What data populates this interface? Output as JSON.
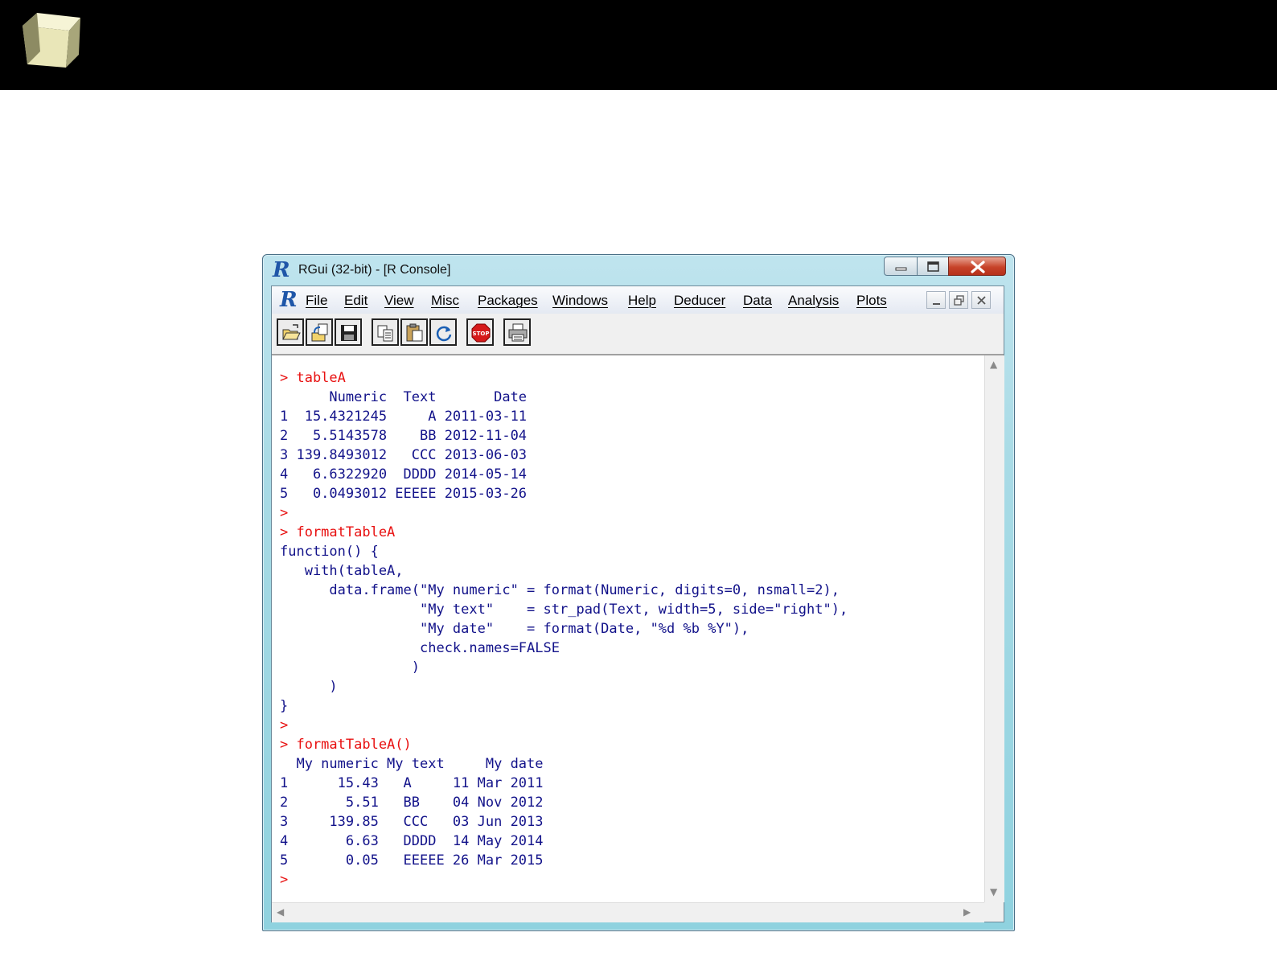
{
  "window": {
    "title": "RGui (32-bit) - [R Console]",
    "logo_letter": "R"
  },
  "menu": {
    "items": [
      {
        "id": "file",
        "label": "File"
      },
      {
        "id": "edit",
        "label": "Edit"
      },
      {
        "id": "view",
        "label": "View"
      },
      {
        "id": "misc",
        "label": "Misc"
      },
      {
        "id": "packages",
        "label": "Packages"
      },
      {
        "id": "windows",
        "label": "Windows"
      },
      {
        "id": "help",
        "label": "Help"
      },
      {
        "id": "deducer",
        "label": "Deducer"
      },
      {
        "id": "data",
        "label": "Data"
      },
      {
        "id": "analysis",
        "label": "Analysis"
      },
      {
        "id": "plots",
        "label": "Plots"
      }
    ]
  },
  "toolbar": {
    "buttons": [
      "open-script-icon",
      "load-workspace-icon",
      "save-icon",
      "copy-icon",
      "paste-icon",
      "refresh-icon",
      "stop-icon",
      "print-icon"
    ],
    "stop_label": "STOP"
  },
  "console": {
    "lines": [
      {
        "kind": "in",
        "text": "> tableA"
      },
      {
        "kind": "out",
        "text": "      Numeric  Text       Date"
      },
      {
        "kind": "out",
        "text": "1  15.4321245     A 2011-03-11"
      },
      {
        "kind": "out",
        "text": "2   5.5143578    BB 2012-11-04"
      },
      {
        "kind": "out",
        "text": "3 139.8493012   CCC 2013-06-03"
      },
      {
        "kind": "out",
        "text": "4   6.6322920  DDDD 2014-05-14"
      },
      {
        "kind": "out",
        "text": "5   0.0493012 EEEEE 2015-03-26"
      },
      {
        "kind": "in",
        "text": ">"
      },
      {
        "kind": "in",
        "text": "> formatTableA"
      },
      {
        "kind": "out",
        "text": "function() {"
      },
      {
        "kind": "out",
        "text": "   with(tableA,"
      },
      {
        "kind": "out",
        "text": "      data.frame(\"My numeric\" = format(Numeric, digits=0, nsmall=2),"
      },
      {
        "kind": "out",
        "text": "                 \"My text\"    = str_pad(Text, width=5, side=\"right\"),"
      },
      {
        "kind": "out",
        "text": "                 \"My date\"    = format(Date, \"%d %b %Y\"),"
      },
      {
        "kind": "out",
        "text": "                 check.names=FALSE"
      },
      {
        "kind": "out",
        "text": "                )"
      },
      {
        "kind": "out",
        "text": "      )"
      },
      {
        "kind": "out",
        "text": "}"
      },
      {
        "kind": "in",
        "text": ">"
      },
      {
        "kind": "in",
        "text": "> formatTableA()"
      },
      {
        "kind": "out",
        "text": "  My numeric My text     My date"
      },
      {
        "kind": "out",
        "text": "1      15.43   A     11 Mar 2011"
      },
      {
        "kind": "out",
        "text": "2       5.51   BB    04 Nov 2012"
      },
      {
        "kind": "out",
        "text": "3     139.85   CCC   03 Jun 2013"
      },
      {
        "kind": "out",
        "text": "4       6.63   DDDD  14 May 2014"
      },
      {
        "kind": "out",
        "text": "5       0.05   EEEEE 26 Mar 2015"
      },
      {
        "kind": "in",
        "text": ">"
      }
    ]
  },
  "colors": {
    "input_text": "#e81010",
    "output_text": "#12128a",
    "banner": "#000000"
  }
}
